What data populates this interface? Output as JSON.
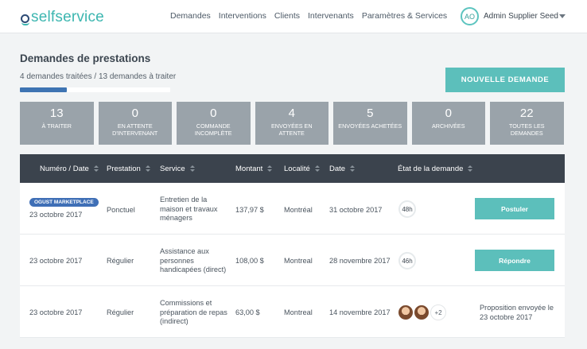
{
  "app": {
    "logo_text": "selfservice"
  },
  "nav": {
    "items": [
      {
        "label": "Demandes"
      },
      {
        "label": "Interventions"
      },
      {
        "label": "Clients"
      },
      {
        "label": "Intervenants"
      },
      {
        "label": "Paramètres & Services"
      }
    ]
  },
  "user": {
    "initials": "AO",
    "name": "Admin Supplier Seed"
  },
  "header": {
    "title": "Demandes de prestations",
    "progress_text": "4 demandes traitées / 13 demandes à traiter",
    "progress_ratio": 0.31,
    "new_button": "NOUVELLE DEMANDE"
  },
  "stats": [
    {
      "count": "13",
      "label": "À TRAITER"
    },
    {
      "count": "0",
      "label": "EN ATTENTE D'INTERVENANT"
    },
    {
      "count": "0",
      "label": "COMMANDE INCOMPLÈTE"
    },
    {
      "count": "4",
      "label": "ENVOYÉES EN ATTENTE"
    },
    {
      "count": "5",
      "label": "ENVOYÉES ACHETÉES"
    },
    {
      "count": "0",
      "label": "ARCHIVÉES"
    },
    {
      "count": "22",
      "label": "TOUTES LES DEMANDES"
    }
  ],
  "table": {
    "columns": [
      "Numéro / Date",
      "Prestation",
      "Service",
      "Montant",
      "Localité",
      "Date",
      "État de la demande"
    ],
    "rows": [
      {
        "badge": "OGUST MARKETPLACE",
        "date": "23 octobre 2017",
        "prestation": "Ponctuel",
        "service": "Entretien de la maison et travaux ménagers",
        "amount": "137,97 $",
        "locality": "Montréal",
        "req_date": "31 octobre 2017",
        "timer": "48h",
        "action": "Postuler"
      },
      {
        "date": "23 octobre 2017",
        "prestation": "Régulier",
        "service": "Assistance aux personnes handicapées (direct)",
        "amount": "108,00 $",
        "locality": "Montreal",
        "req_date": "28 novembre 2017",
        "timer": "46h",
        "action": "Répondre"
      },
      {
        "date": "23 octobre 2017",
        "prestation": "Régulier",
        "service": "Commissions et préparation de repas (indirect)",
        "amount": "63,00 $",
        "locality": "Montreal",
        "req_date": "14 novembre 2017",
        "extra_count": "+2",
        "status": "Proposition envoyée le 23 octobre 2017"
      }
    ]
  },
  "colors": {
    "accent": "#5cbfbb",
    "brand_blue": "#3f6fb6",
    "header_dark": "#3b434d",
    "card_gray": "#9aa3aa"
  }
}
